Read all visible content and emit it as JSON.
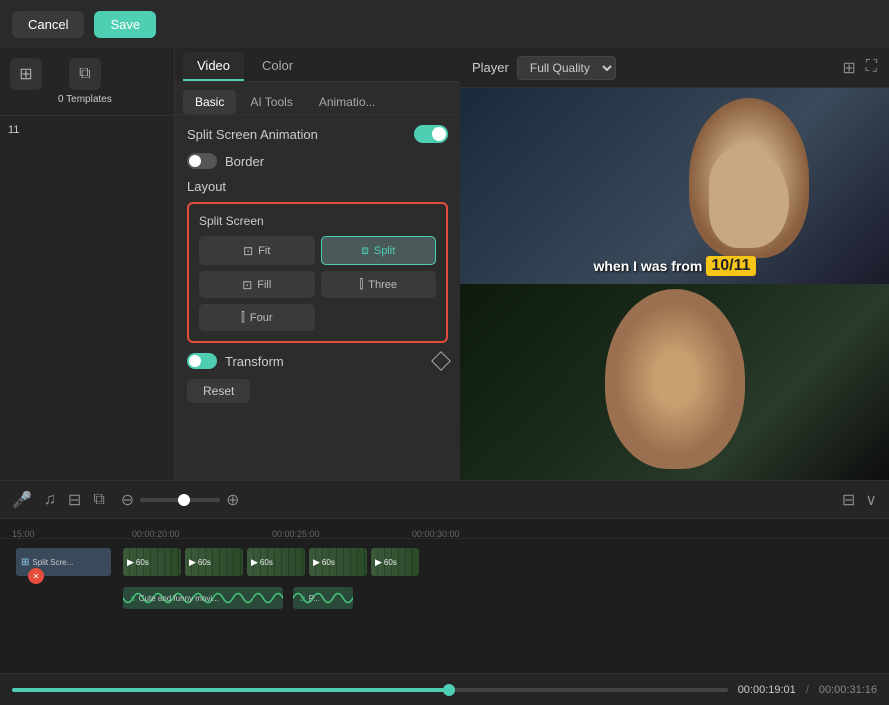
{
  "topbar": {
    "cancel_label": "Cancel",
    "save_label": "Save"
  },
  "sidebar": {
    "templates_count": "0 Templates",
    "track_number": "11"
  },
  "tabs": {
    "video_label": "Video",
    "color_label": "Color"
  },
  "subtabs": {
    "basic_label": "Basic",
    "ai_tools_label": "AI Tools",
    "animation_label": "Animatio..."
  },
  "panel": {
    "split_animation_label": "Split Screen Animation",
    "border_label": "Border",
    "layout_label": "Layout",
    "split_screen_title": "Split Screen",
    "fit_label": "Fit",
    "split_label": "Split",
    "fill_label": "Fill",
    "three_label": "Three",
    "four_label": "Four",
    "transform_label": "Transform",
    "reset_label": "Reset"
  },
  "player": {
    "player_label": "Player",
    "quality_label": "Full Quality",
    "subtitle_text": "when I was from",
    "subtitle_highlight": "10/11",
    "time_current": "00:00:19:01",
    "time_total": "00:00:31:16"
  },
  "timeline": {
    "marks": [
      "15:00",
      "00:00:20:00",
      "00:00:25:00",
      "00:00:30:00"
    ],
    "split_clip_label": "Split Scre...",
    "clip_duration": "60s",
    "audio1_label": "Cute and funny movi...",
    "audio2_label": "P...",
    "progress_percent": 61
  }
}
